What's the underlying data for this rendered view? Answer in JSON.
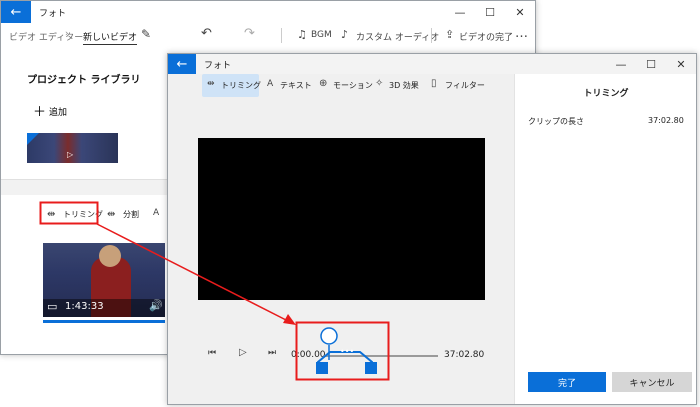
{
  "back_win": {
    "title": "フォト",
    "breadcrumb_root": "ビデオ エディター",
    "breadcrumb_sep": "›",
    "project_name": "新しいビデオ",
    "toolbar": {
      "bgm": "BGM",
      "custom_audio": "カスタム オーディオ",
      "finish": "ビデオの完了",
      "more": "…"
    },
    "library_title": "プロジェクト ライブラリ",
    "add_label": "追加",
    "storyboard": {
      "trim": "トリミング",
      "split": "分割",
      "text_glyph": "A"
    },
    "preview_time": "1:43:33"
  },
  "front_win": {
    "title": "フォト",
    "tabs": [
      {
        "label": "トリミング",
        "active": true
      },
      {
        "label": "テキスト",
        "active": false
      },
      {
        "label": "モーション",
        "active": false
      },
      {
        "label": "3D 効果",
        "active": false
      },
      {
        "label": "フィルター",
        "active": false
      }
    ],
    "panel_title": "トリミング",
    "clip_length_label": "クリップの長さ",
    "clip_length_value": "37:02.80",
    "start_time": "0:00.00",
    "end_time": "37:02.80",
    "done_label": "完了",
    "cancel_label": "キャンセル"
  },
  "colors": {
    "accent": "#0a6fd8",
    "annotation": "#e81c1c"
  }
}
